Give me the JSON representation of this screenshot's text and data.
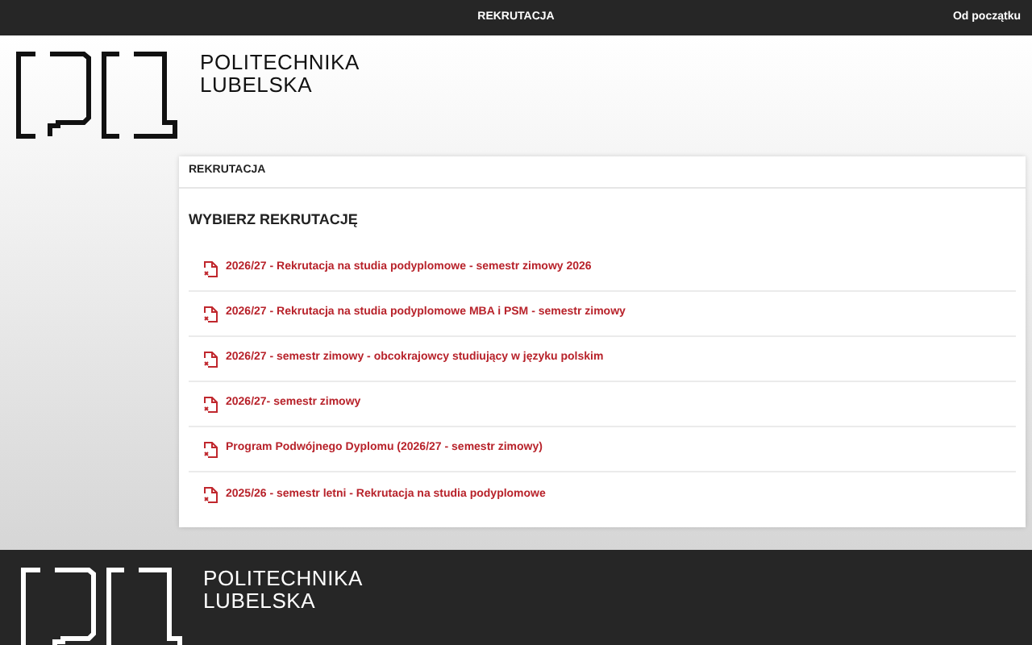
{
  "top_bar": {
    "title": "REKRUTACJA",
    "back_link": "Od początku"
  },
  "header": {
    "logo_lines": [
      "POLITECHNIKA",
      "LUBELSKA"
    ]
  },
  "card": {
    "header": "REKRUTACJA",
    "title": "WYBIERZ REKRUTACJĘ",
    "items": [
      {
        "label": "2026/27 - Rekrutacja na studia podyplomowe - semestr zimowy 2026"
      },
      {
        "label": "2026/27 - Rekrutacja na studia podyplomowe MBA i PSM - semestr zimowy"
      },
      {
        "label": "2026/27 - semestr zimowy - obcokrajowcy studiujący w języku polskim"
      },
      {
        "label": "2026/27- semestr zimowy"
      },
      {
        "label": "Program Podwójnego Dyplomu (2026/27 - semestr zimowy)"
      },
      {
        "label": "2025/26 - semestr letni - Rekrutacja na studia podyplomowe"
      }
    ]
  },
  "footer": {
    "logo_lines": [
      "POLITECHNIKA",
      "LUBELSKA"
    ]
  }
}
